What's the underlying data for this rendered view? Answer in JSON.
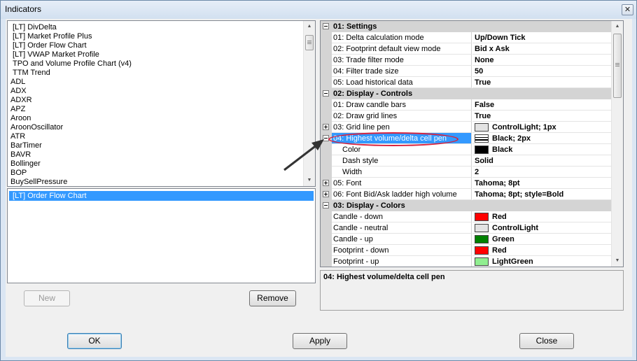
{
  "window": {
    "title": "Indicators",
    "close_glyph": "✕"
  },
  "indicator_list": {
    "items": [
      "[LT] DivDelta",
      "[LT] Market Profile Plus",
      "[LT] Order Flow Chart",
      "[LT] VWAP Market Profile",
      "TPO and Volume Profile Chart (v4)",
      "TTM Trend",
      "ADL",
      "ADX",
      "ADXR",
      "APZ",
      "Aroon",
      "AroonOscillator",
      "ATR",
      "BarTimer",
      "BAVR",
      "Bollinger",
      "BOP",
      "BuySellPressure"
    ]
  },
  "applied_list": {
    "items": [
      "[LT] Order Flow Chart"
    ]
  },
  "buttons": {
    "new": "New",
    "remove": "Remove",
    "ok": "OK",
    "apply": "Apply",
    "close": "Close"
  },
  "scroll": {
    "up_glyph": "▲",
    "down_glyph": "▼"
  },
  "property_grid": {
    "rows": [
      {
        "kind": "category",
        "name": "01: Settings",
        "expanded": true
      },
      {
        "kind": "prop",
        "name": "01: Delta calculation mode",
        "value": "Up/Down Tick"
      },
      {
        "kind": "prop",
        "name": "02: Footprint default view mode",
        "value": "Bid x Ask"
      },
      {
        "kind": "prop",
        "name": "03: Trade filter mode",
        "value": "None"
      },
      {
        "kind": "prop",
        "name": "04: Filter trade size",
        "value": "50"
      },
      {
        "kind": "prop",
        "name": "05: Load historical data",
        "value": "True"
      },
      {
        "kind": "category",
        "name": "02: Display - Controls",
        "expanded": true
      },
      {
        "kind": "prop",
        "name": "01: Draw candle bars",
        "value": "False"
      },
      {
        "kind": "prop",
        "name": "02: Draw grid lines",
        "value": "True"
      },
      {
        "kind": "prop",
        "name": "03: Grid line pen",
        "value": "ControlLight;  1px",
        "expander": "plus",
        "swatch": "#e3e3e3"
      },
      {
        "kind": "prop",
        "name": "04: Highest volume/delta cell pen",
        "value": "Black;  2px",
        "expander": "minus",
        "pen": true,
        "selected": true
      },
      {
        "kind": "sub",
        "name": "Color",
        "value": "Black",
        "swatch": "#000000"
      },
      {
        "kind": "sub",
        "name": "Dash style",
        "value": "Solid"
      },
      {
        "kind": "sub",
        "name": "Width",
        "value": "2"
      },
      {
        "kind": "prop",
        "name": "05: Font",
        "value": "Tahoma;  8pt",
        "expander": "plus"
      },
      {
        "kind": "prop",
        "name": "06: Font Bid/Ask ladder high volume",
        "value": "Tahoma;  8pt;  style=Bold",
        "expander": "plus"
      },
      {
        "kind": "category",
        "name": "03: Display - Colors",
        "expanded": true
      },
      {
        "kind": "prop",
        "name": "Candle - down",
        "value": "Red",
        "swatch": "#ff0000"
      },
      {
        "kind": "prop",
        "name": "Candle - neutral",
        "value": "ControlLight",
        "swatch": "#e3e3e3"
      },
      {
        "kind": "prop",
        "name": "Candle - up",
        "value": "Green",
        "swatch": "#008000"
      },
      {
        "kind": "prop",
        "name": "Footprint - down",
        "value": "Red",
        "swatch": "#ff0000"
      },
      {
        "kind": "prop",
        "name": "Footprint - up",
        "value": "LightGreen",
        "swatch": "#90ee90"
      }
    ]
  },
  "description": {
    "title": "04: Highest volume/delta cell pen"
  },
  "colors": {
    "selection": "#3399ff",
    "annotation": "#d8213c",
    "arrow": "#333333"
  }
}
